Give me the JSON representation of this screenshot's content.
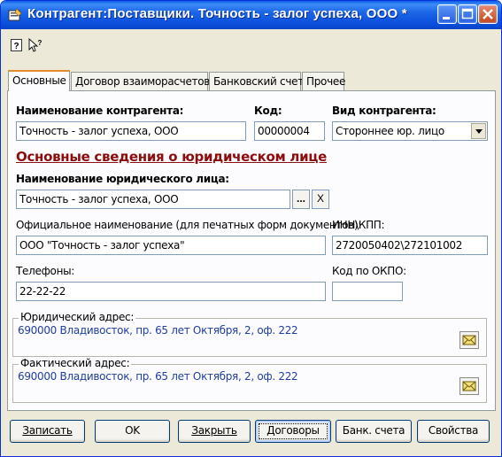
{
  "window": {
    "title": "Контрагент:Поставщики. Точность - залог успеха, ООО *"
  },
  "toolbar": {
    "buttons": [
      "help-icon",
      "whats-this-icon"
    ]
  },
  "tabs": [
    {
      "label": "Основные",
      "active": true
    },
    {
      "label": "Договор взаиморасчетов",
      "active": false
    },
    {
      "label": "Банковский счет",
      "active": false
    },
    {
      "label": "Прочее",
      "active": false
    }
  ],
  "main": {
    "name_label": "Наименование контрагента:",
    "name_value": "Точность - залог успеха, ООО",
    "code_label": "Код:",
    "code_value": "00000004",
    "type_label": "Вид контрагента:",
    "type_value": "Стороннее юр. лицо",
    "section_title": "Основные сведения о юридическом лице",
    "legal_name_label": "Наименование юридического лица:",
    "legal_name_value": "Точность - залог успеха, ООО",
    "select_button": "...",
    "clear_button": "X",
    "official_name_label": "Официальное наименование (для печатных форм документов):",
    "official_name_value": "ООО \"Точность - залог успеха\"",
    "inn_label": "ИНН\\КПП:",
    "inn_value": "2720050402\\272101002",
    "phones_label": "Телефоны:",
    "phones_value": "22-22-22",
    "okpo_label": "Код по ОКПО:",
    "okpo_value": "",
    "legal_address_label": "Юридический адрес:",
    "legal_address_value": "690000 Владивосток, пр. 65 лет Октября, 2, оф. 222",
    "actual_address_label": "Фактический адрес:",
    "actual_address_value": "690000 Владивосток, пр. 65 лет Октября, 2, оф. 222"
  },
  "buttons": {
    "save": "Записать",
    "ok": "OK",
    "close": "Закрыть",
    "contracts": "Договоры",
    "bank_accounts": "Банк. счета",
    "properties": "Свойства"
  },
  "colors": {
    "title_bar": "#0b4fdc",
    "section_title": "#8b0d0d",
    "address_text": "#1e3ea0",
    "window_bg": "#ece9d8"
  }
}
